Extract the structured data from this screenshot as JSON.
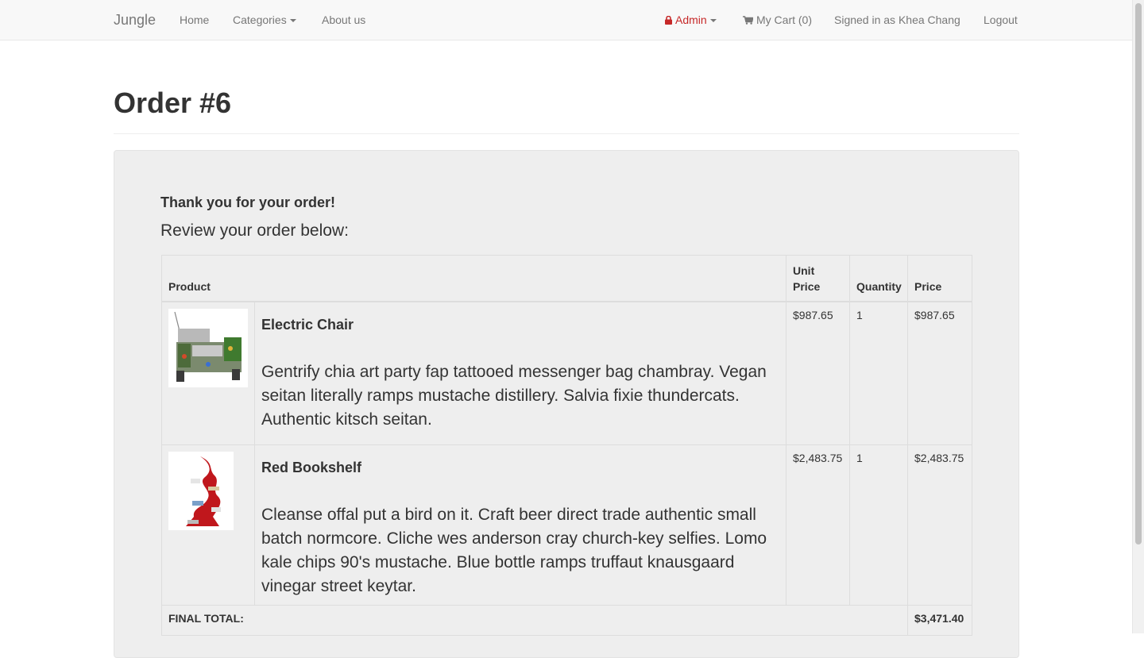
{
  "nav": {
    "brand": "Jungle",
    "home": "Home",
    "categories": "Categories",
    "about": "About us",
    "admin": "Admin",
    "cart": "My Cart (0)",
    "signed_in": "Signed in as Khea Chang",
    "logout": "Logout"
  },
  "page": {
    "title": "Order #6",
    "thanks": "Thank you for your order!",
    "review": "Review your order below:"
  },
  "table": {
    "headers": {
      "product": "Product",
      "unit_price": "Unit Price",
      "quantity": "Quantity",
      "price": "Price"
    },
    "items": [
      {
        "name": "Electric Chair",
        "description": "Gentrify chia art party fap tattooed messenger bag chambray. Vegan seitan literally ramps mustache distillery. Salvia fixie thundercats. Authentic kitsch seitan.",
        "unit_price": "$987.65",
        "quantity": "1",
        "price": "$987.65"
      },
      {
        "name": "Red Bookshelf",
        "description": "Cleanse offal put a bird on it. Craft beer direct trade authentic small batch normcore. Cliche wes anderson cray church-key selfies. Lomo kale chips 90's mustache. Blue bottle ramps truffaut knausgaard vinegar street keytar.",
        "unit_price": "$2,483.75",
        "quantity": "1",
        "price": "$2,483.75"
      }
    ],
    "final_total_label": "FINAL TOTAL:",
    "final_total": "$3,471.40"
  },
  "colors": {
    "navbar_bg": "#f8f8f8",
    "admin_accent": "#c62828",
    "well_bg": "#eeeeee",
    "table_border": "#dddddd"
  },
  "icons": {
    "admin": "lock-icon",
    "cart": "shopping-cart-icon"
  }
}
